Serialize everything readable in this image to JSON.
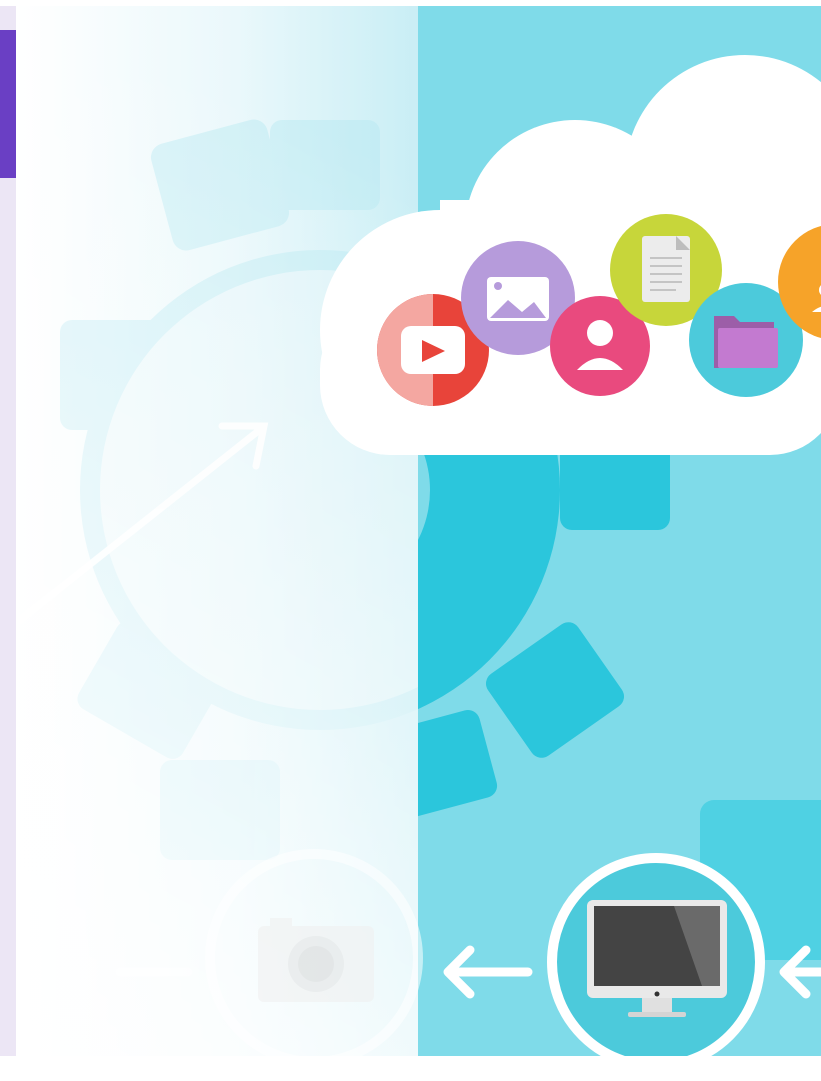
{
  "hero": {
    "description_alt": "",
    "icons": [
      "video-play-icon",
      "image-icon",
      "user-icon",
      "document-icon",
      "folder-icon",
      "orange-user-icon",
      "camera-icon",
      "monitor-icon",
      "arrow-left-icon",
      "arrow-up-right-icon",
      "gear-icon"
    ]
  },
  "colors": {
    "sky": "#7fdbe9",
    "sky_light": "#d9f3f8",
    "gear": "#2bc6dc",
    "accent_purple": "#6a3fc4",
    "panel_lilac": "#ece6f5",
    "cloud": "#ffffff",
    "video_red": "#e8443a",
    "image_lilac": "#b69bdb",
    "user_pink": "#e94a7e",
    "doc_lime": "#c7d63a",
    "folder_teal": "#4ccadb",
    "orange": "#f6a329"
  }
}
